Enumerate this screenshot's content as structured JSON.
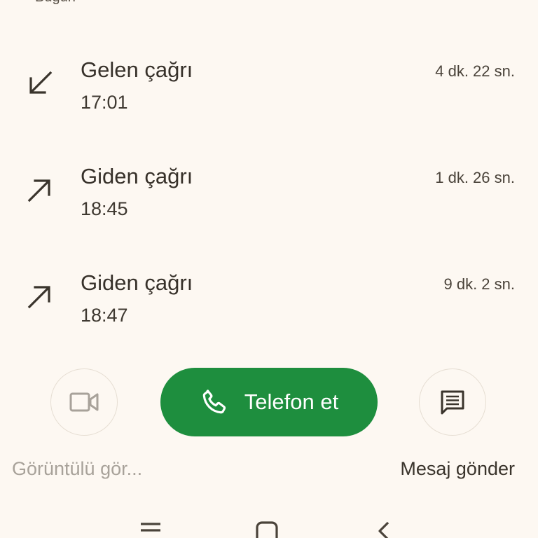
{
  "section_header": "Bugün",
  "calls": [
    {
      "type": "Gelen çağrı",
      "time": "17:01",
      "duration": "4 dk. 22 sn.",
      "direction": "incoming",
      "icon": "call-received-icon"
    },
    {
      "type": "Giden çağrı",
      "time": "18:45",
      "duration": "1 dk. 26 sn.",
      "direction": "outgoing",
      "icon": "call-made-icon"
    },
    {
      "type": "Giden çağrı",
      "time": "18:47",
      "duration": "9 dk. 2 sn.",
      "direction": "outgoing",
      "icon": "call-made-icon"
    }
  ],
  "actions": {
    "video_label": "Görüntülü gör...",
    "call_label": "Telefon et",
    "message_label": "Mesaj gönder"
  },
  "colors": {
    "background": "#fdf8f2",
    "call_button": "#1e8e3e",
    "disabled_text": "#a8a29a"
  },
  "nav": {
    "recents_icon": "recents-icon",
    "home_icon": "home-icon",
    "back_icon": "back-icon"
  }
}
